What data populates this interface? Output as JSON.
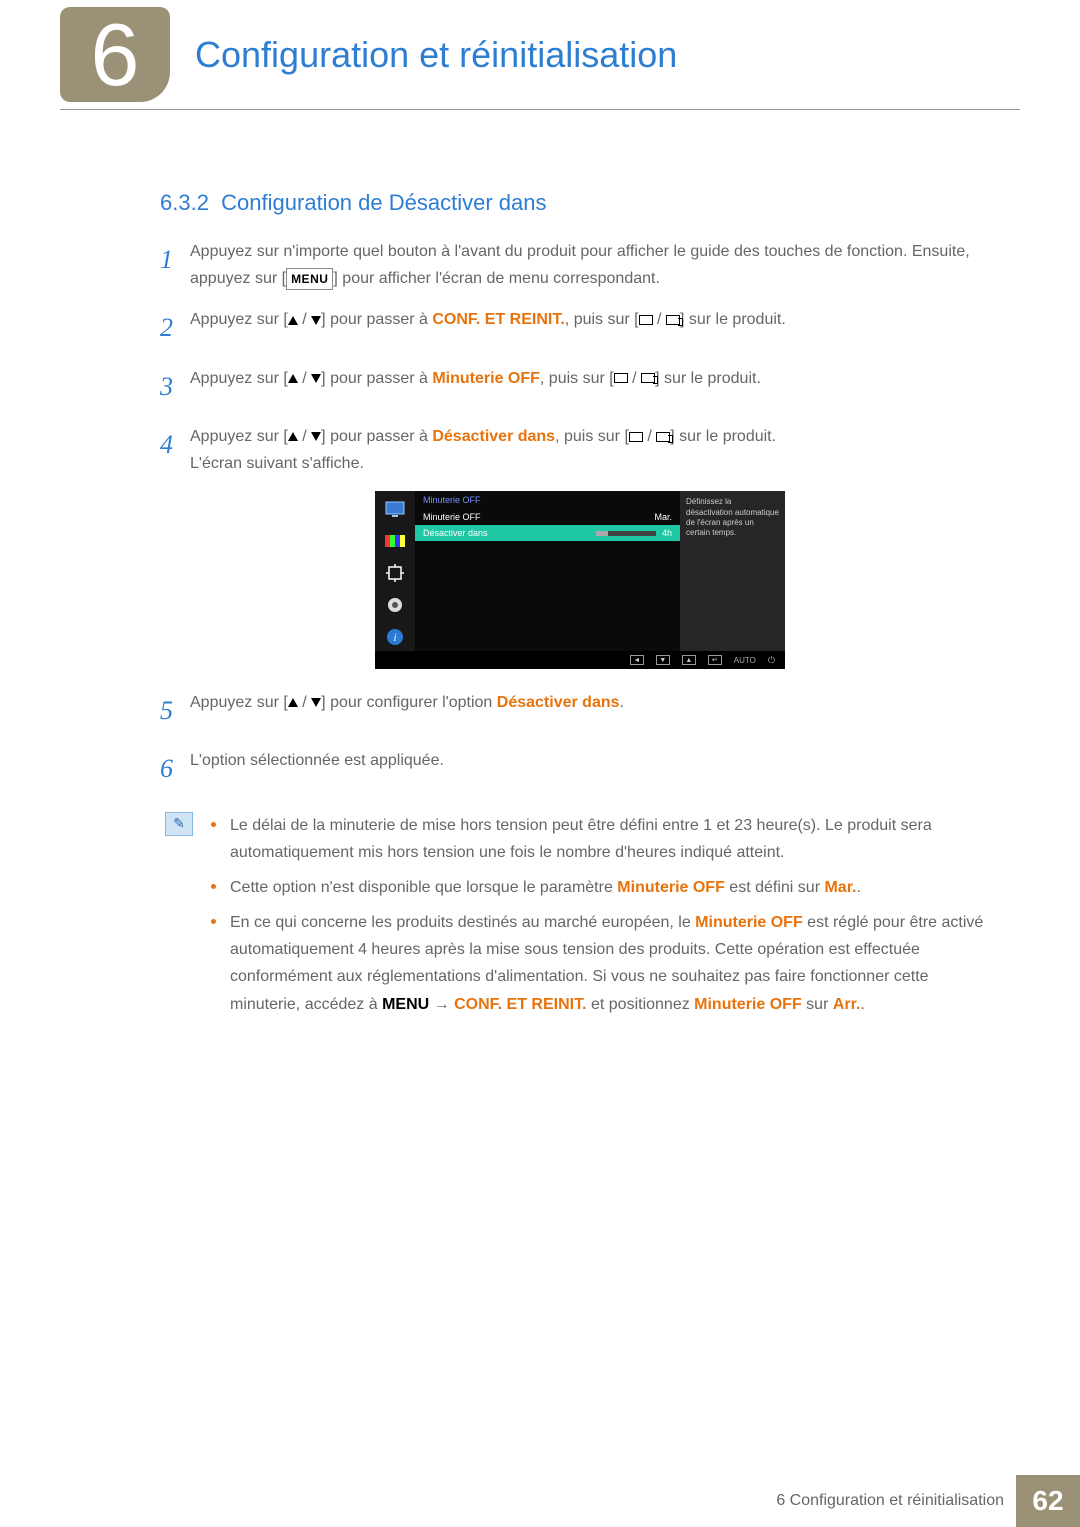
{
  "chapter": {
    "number": "6",
    "title": "Configuration et réinitialisation"
  },
  "subsection": {
    "number": "6.3.2",
    "title": "Configuration de Désactiver dans"
  },
  "steps": [
    {
      "n": "1",
      "pre": "Appuyez sur n'importe quel bouton à l'avant du produit pour afficher le guide des touches de fonction. Ensuite, appuyez sur [",
      "btn": "MENU",
      "post": "] pour afficher l'écran de menu correspondant."
    },
    {
      "n": "2",
      "a": "Appuyez sur [",
      "b": "] pour passer à ",
      "hl": "CONF. ET REINIT.",
      "c": ", puis sur [",
      "d": "] sur le produit."
    },
    {
      "n": "3",
      "a": "Appuyez sur [",
      "b": "] pour passer à ",
      "hl": "Minuterie OFF",
      "c": ", puis sur [",
      "d": "] sur le produit."
    },
    {
      "n": "4",
      "a": "Appuyez sur [",
      "b": "] pour passer à ",
      "hl": "Désactiver dans",
      "c": ", puis sur [",
      "d": "] sur le produit.",
      "e": "L'écran suivant s'affiche."
    },
    {
      "n": "5",
      "a": "Appuyez sur [",
      "b": "] pour configurer l'option ",
      "hl": "Désactiver dans",
      "c": "."
    },
    {
      "n": "6",
      "plain": "L'option sélectionnée est appliquée."
    }
  ],
  "osd": {
    "header": "Minuterie OFF",
    "row1": {
      "label": "Minuterie OFF",
      "value": "Mar."
    },
    "row2": {
      "label": "Désactiver dans",
      "value": "4h"
    },
    "info": "Définissez la désactivation automatique de l'écran après un certain temps.",
    "auto": "AUTO"
  },
  "notes": [
    {
      "text": "Le délai de la minuterie de mise hors tension peut être défini entre 1 et 23 heure(s). Le produit sera automatiquement mis hors tension une fois le nombre d'heures indiqué atteint."
    },
    {
      "pre": "Cette option n'est disponible que lorsque le paramètre ",
      "hl1": "Minuterie OFF",
      "mid": " est défini sur ",
      "hl2": "Mar.",
      "post": "."
    },
    {
      "pre": "En ce qui concerne les produits destinés au marché européen, le ",
      "hl1": "Minuterie OFF",
      "t2": " est réglé pour être activé automatiquement 4 heures après la mise sous tension des produits. Cette opération est effectuée conformément aux réglementations d'alimentation. Si vous ne souhaitez pas faire fonctionner cette minuterie, accédez à ",
      "b1": "MENU",
      "arrow": " → ",
      "hl2": "CONF. ET REINIT.",
      "t3": " et positionnez ",
      "hl3": "Minuterie OFF",
      "t4": " sur ",
      "hl4": "Arr.",
      "post": "."
    }
  ],
  "footer": {
    "label": "6 Configuration et réinitialisation",
    "page": "62"
  }
}
